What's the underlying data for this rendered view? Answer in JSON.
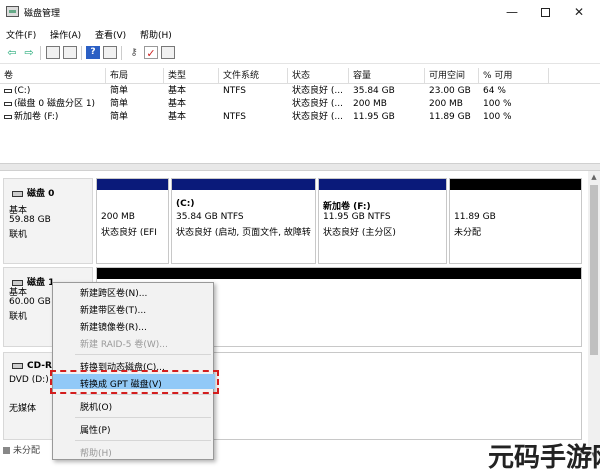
{
  "window": {
    "title": "磁盘管理",
    "min_glyph": "—",
    "close_glyph": "✕"
  },
  "menu": [
    "文件(F)",
    "操作(A)",
    "查看(V)",
    "帮助(H)"
  ],
  "toolbar_icons": [
    "back-arrow-icon",
    "forward-arrow-icon",
    "properties-icon",
    "help-icon",
    "view-icon",
    "key-icon",
    "check-icon",
    "list-icon"
  ],
  "toolbar": {
    "back": "⇦",
    "forward": "⇨",
    "help": "?",
    "key": "⚷",
    "check": "✓"
  },
  "table": {
    "columns": [
      "卷",
      "布局",
      "类型",
      "文件系统",
      "状态",
      "容量",
      "可用空间",
      "% 可用"
    ],
    "rows": [
      [
        "(C:)",
        "简单",
        "基本",
        "NTFS",
        "状态良好 (...",
        "35.84 GB",
        "23.00 GB",
        "64 %"
      ],
      [
        "(磁盘 0 磁盘分区 1)",
        "简单",
        "基本",
        "",
        "状态良好 (...",
        "200 MB",
        "200 MB",
        "100 %"
      ],
      [
        "新加卷 (F:)",
        "简单",
        "基本",
        "NTFS",
        "状态良好 (...",
        "11.95 GB",
        "11.89 GB",
        "100 %"
      ]
    ]
  },
  "disks": [
    {
      "name": "磁盘 0",
      "type": "基本",
      "size": "59.88 GB",
      "status": "联机",
      "partitions": [
        {
          "title": "",
          "size": "200 MB",
          "status": "状态良好 (EFI",
          "bar": "#0a1a7a"
        },
        {
          "title": "(C:)",
          "size": "35.84 GB NTFS",
          "status": "状态良好 (启动, 页面文件, 故障转",
          "bar": "#0a1a7a"
        },
        {
          "title": "新加卷 (F:)",
          "size": "11.95 GB NTFS",
          "status": "状态良好 (主分区)",
          "bar": "#0a1a7a"
        },
        {
          "title": "",
          "size": "11.89 GB",
          "status": "未分配",
          "bar": "#000000"
        }
      ]
    },
    {
      "name": "磁盘 1",
      "type": "基本",
      "size": "60.00 GB",
      "status": "联机"
    },
    {
      "name": "CD-R",
      "type": "DVD (D:)",
      "size": "",
      "status": "无媒体"
    }
  ],
  "context_menu": {
    "items": [
      {
        "label": "新建跨区卷(N)...",
        "disabled": false
      },
      {
        "label": "新建带区卷(T)...",
        "disabled": false
      },
      {
        "label": "新建镜像卷(R)...",
        "disabled": false
      },
      {
        "label": "新建 RAID-5 卷(W)...",
        "disabled": true
      },
      {
        "label": "转换到动态磁盘(C)...",
        "disabled": false
      },
      {
        "label": "转换成 GPT 磁盘(V)",
        "disabled": false,
        "highlighted": true
      },
      {
        "label": "脱机(O)",
        "disabled": false
      },
      {
        "label": "属性(P)",
        "disabled": false
      },
      {
        "label": "帮助(H)",
        "disabled": true
      }
    ]
  },
  "legend": {
    "unallocated": "未分配"
  },
  "watermark": "元码手游网",
  "colors": {
    "partition_bar": "#0a1a7a",
    "unallocated_bar": "#000000",
    "highlight": "#91c9f7",
    "dash": "#d31d1d"
  }
}
